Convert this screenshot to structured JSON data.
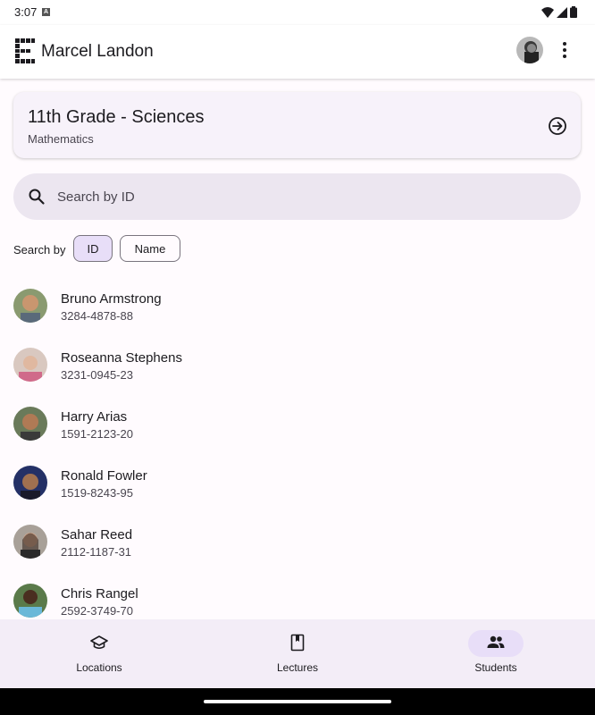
{
  "status": {
    "time": "3:07"
  },
  "app": {
    "title": "Marcel Landon"
  },
  "class_card": {
    "title": "11th Grade - Sciences",
    "subtitle": "Mathematics"
  },
  "search": {
    "placeholder": "Search by ID",
    "value": ""
  },
  "search_by": {
    "label": "Search by",
    "chips": [
      {
        "label": "ID",
        "selected": true
      },
      {
        "label": "Name",
        "selected": false
      }
    ]
  },
  "students": [
    {
      "name": "Bruno Armstrong",
      "id": "3284-4878-88",
      "avatar_color": "#7a6a55"
    },
    {
      "name": "Roseanna Stephens",
      "id": "3231-0945-23",
      "avatar_color": "#c88a8f"
    },
    {
      "name": "Harry Arias",
      "id": "1591-2123-20",
      "avatar_color": "#6b5a40"
    },
    {
      "name": "Ronald Fowler",
      "id": "1519-8243-95",
      "avatar_color": "#2f3a6a"
    },
    {
      "name": "Sahar Reed",
      "id": "2112-1187-31",
      "avatar_color": "#5a5048"
    },
    {
      "name": "Chris Rangel",
      "id": "2592-3749-70",
      "avatar_color": "#3a5a3a"
    }
  ],
  "bottom_nav": [
    {
      "label": "Locations",
      "icon": "school-icon",
      "active": false
    },
    {
      "label": "Lectures",
      "icon": "book-icon",
      "active": false
    },
    {
      "label": "Students",
      "icon": "people-icon",
      "active": true
    }
  ],
  "colors": {
    "accent": "#e8def8",
    "surface": "#f7f2fa",
    "search_bg": "#ece6f0",
    "nav_bg": "#f3edf7"
  }
}
